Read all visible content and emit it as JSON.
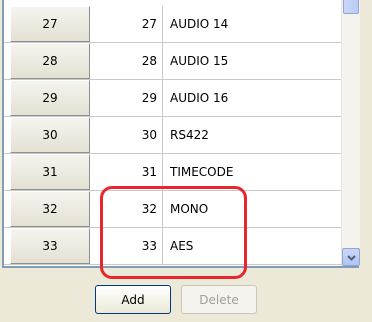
{
  "table": {
    "rows": [
      {
        "header": "27",
        "number": "27",
        "name": "AUDIO 14"
      },
      {
        "header": "28",
        "number": "28",
        "name": "AUDIO 15"
      },
      {
        "header": "29",
        "number": "29",
        "name": "AUDIO 16"
      },
      {
        "header": "30",
        "number": "30",
        "name": "RS422"
      },
      {
        "header": "31",
        "number": "31",
        "name": "TIMECODE"
      },
      {
        "header": "32",
        "number": "32",
        "name": "MONO"
      },
      {
        "header": "33",
        "number": "33",
        "name": "AES"
      }
    ]
  },
  "buttons": {
    "add_label": "Add",
    "delete_label": "Delete"
  },
  "icons": {
    "scroll_down": "chevron-down-icon"
  },
  "colors": {
    "highlight": "#e8262d",
    "grid_border": "#7f9db9",
    "window_bg": "#ece9d8"
  }
}
